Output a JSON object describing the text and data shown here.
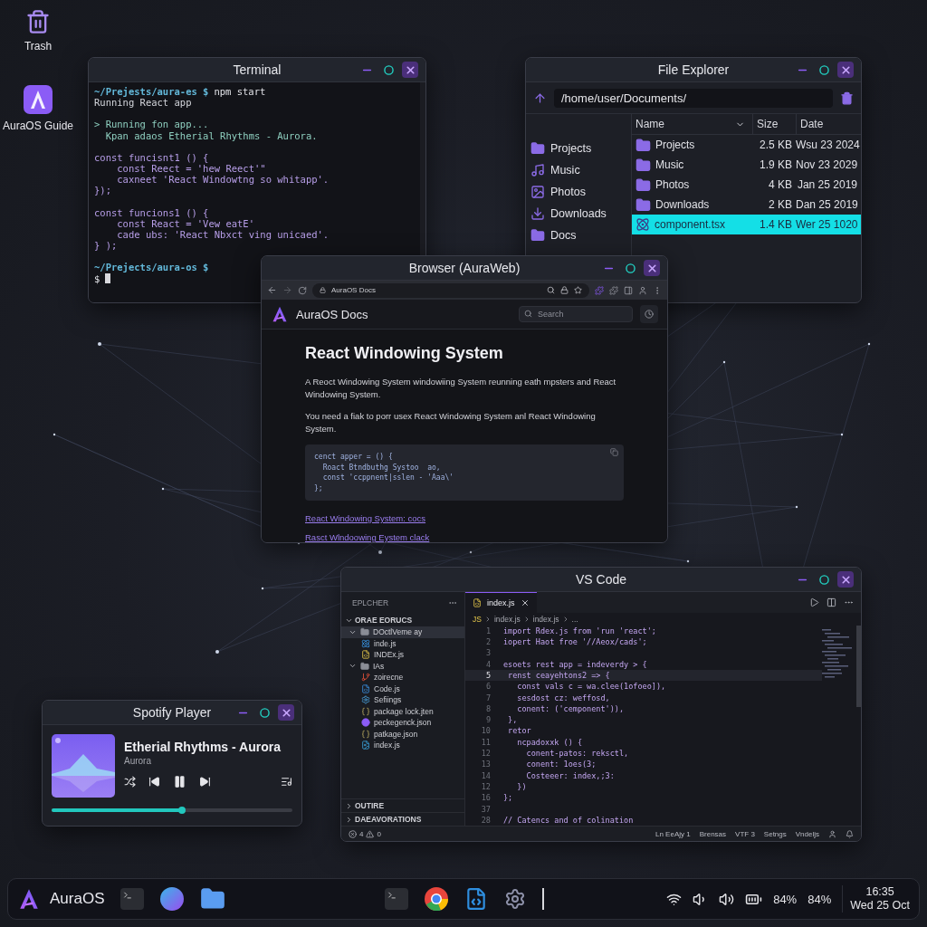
{
  "desktop_icons": [
    {
      "label": "Trash",
      "kind": "trash"
    },
    {
      "label": "AuraOS Guide",
      "kind": "guide"
    }
  ],
  "terminal": {
    "title": "Terminal",
    "blocks": [
      [
        {
          "kind": "prompt",
          "path": "~/Prejests/aura-es $",
          "command": "npm start"
        },
        {
          "kind": "output",
          "text": "Running React app"
        }
      ],
      [
        {
          "kind": "info",
          "text": "> Running fon app..."
        },
        {
          "kind": "info",
          "text": "  Kpan adaos Etherial Rhythms - Aurora."
        }
      ],
      [
        {
          "kind": "code",
          "text": "const funcisnt1 () {"
        },
        {
          "kind": "code",
          "text": "    const Reect = 'hew Reect'\""
        },
        {
          "kind": "code",
          "text": "    caxneet 'React Windowtng so whitapp'."
        },
        {
          "kind": "code",
          "text": "});"
        }
      ],
      [
        {
          "kind": "code",
          "text": "const funcions1 () {"
        },
        {
          "kind": "code",
          "text": "    const React = 'Vew eatE'"
        },
        {
          "kind": "code",
          "text": "    cade ubs: 'React Nbxct ving unicaed'."
        },
        {
          "kind": "code",
          "text": "} );"
        }
      ],
      [
        {
          "kind": "prompt",
          "path": "~/Prejects/aura-os $"
        },
        {
          "kind": "cursor",
          "text": "$"
        }
      ]
    ]
  },
  "file_explorer": {
    "title": "File Explorer",
    "path": "/home/user/Documents/",
    "sidebar": [
      {
        "label": "Projects",
        "kind": "folder"
      },
      {
        "label": "Music",
        "kind": "music"
      },
      {
        "label": "Photos",
        "kind": "photo"
      },
      {
        "label": "Downloads",
        "kind": "download"
      },
      {
        "label": "Docs",
        "kind": "folder"
      }
    ],
    "columns": [
      "Name",
      "Size",
      "Date"
    ],
    "rows": [
      {
        "name": "Projects",
        "size": "2.5 KB",
        "date": "Wsu 23 2024",
        "kind": "folder",
        "selected": false
      },
      {
        "name": "Music",
        "size": "1.9 KB",
        "date": "Nov 23 2029",
        "kind": "folder",
        "selected": false
      },
      {
        "name": "Photos",
        "size": "4 KB",
        "date": "Jan 25 2019",
        "kind": "folder",
        "selected": false
      },
      {
        "name": "Downloads",
        "size": "2 KB",
        "date": "Dan 25 2019",
        "kind": "folder",
        "selected": false
      },
      {
        "name": "component.tsx",
        "size": "1.4 KB",
        "date": "Wer 25 1020",
        "kind": "react",
        "selected": true
      }
    ]
  },
  "browser": {
    "title": "Browser (AuraWeb)",
    "address": "AuraOS Docs",
    "site_title": "AuraOS Docs",
    "search": {
      "placeholder": "Search"
    },
    "heading": "React Windowing System",
    "paragraphs": [
      "A Reoct Windowing System windowiing System reunning eath mpsters and React Windowing System.",
      "You need a fiak to porr usex React Windowing System anl React Windowing System."
    ],
    "code_lines": [
      "cenct apper = () {",
      "  Roact Btndbuthg Systoo  ao,",
      "  const 'ccppnent|sslen - 'Aaa\\'",
      "};"
    ],
    "links": [
      "React Windowing System: cocs",
      "Rasct Wlndoowing Eystem clack"
    ]
  },
  "vscode": {
    "title": "VS Code",
    "explorer_title": "EPLCHER",
    "section": "ORAE EORUCS",
    "tree": [
      {
        "label": "DOctlVeme ay",
        "kind": "folder",
        "expanded": true,
        "selected": true,
        "children": [
          {
            "label": "inde.js",
            "kind": "react",
            "selected": false
          },
          {
            "label": "INDEx.js",
            "kind": "js",
            "selected": false
          }
        ]
      },
      {
        "label": "IAs",
        "kind": "folder",
        "expanded": true,
        "selected": false,
        "children": [
          {
            "label": "zoirecne",
            "kind": "git",
            "selected": false
          },
          {
            "label": "Code.js",
            "kind": "vscode",
            "selected": false
          },
          {
            "label": "Sefiings",
            "kind": "settings",
            "selected": false
          },
          {
            "label": "package lock.jten",
            "kind": "json",
            "selected": false
          },
          {
            "label": "peckegenck.json",
            "kind": "purple",
            "selected": false
          },
          {
            "label": "patkage.json",
            "kind": "json",
            "selected": false
          },
          {
            "label": "index.js",
            "kind": "image",
            "selected": false
          }
        ]
      }
    ],
    "panels": [
      {
        "label": "OUTIRE",
        "expanded": false
      },
      {
        "label": "DAEAVORATIONS",
        "expanded": false
      }
    ],
    "tabs": [
      {
        "label": "index.js",
        "selected": true
      }
    ],
    "breadcrumb": [
      "JS",
      "index.js",
      "index.js",
      "..."
    ],
    "code_lines": [
      {
        "num": "1",
        "text": "import Rdex.js from 'run 'react';",
        "current": false
      },
      {
        "num": "2",
        "text": "iopert Haot froe '//Aeox/cads';",
        "current": false
      },
      {
        "num": "3",
        "current": false
      },
      {
        "num": "4",
        "text": "esoets rest app = indeverdy > {",
        "current": false
      },
      {
        "num": "5",
        "text": " renst ceayehtons2 => {",
        "current": true
      },
      {
        "num": "6",
        "text": "   const vals c = wa.clee(1ofoeo]),",
        "current": false
      },
      {
        "num": "7",
        "text": "   sesdost cz: weffosd,",
        "current": false
      },
      {
        "num": "8",
        "text": "   conent: ('cemponent')),",
        "current": false
      },
      {
        "num": "9",
        "text": " },",
        "current": false
      },
      {
        "num": "10",
        "text": " retor",
        "current": false
      },
      {
        "num": "11",
        "text": "   ncpadoxxk () {",
        "current": false
      },
      {
        "num": "12",
        "text": "     conent-patos: reksctl,",
        "current": false
      },
      {
        "num": "13",
        "text": "     conent: 1oes(3;",
        "current": false
      },
      {
        "num": "14",
        "text": "     Costeeer: index,;3:",
        "current": false
      },
      {
        "num": "12",
        "text": "   })",
        "current": false
      },
      {
        "num": "16",
        "text": "};",
        "current": false
      },
      {
        "num": "37",
        "current": false
      },
      {
        "num": "28",
        "text": "// Catencs and of colination",
        "current": false
      }
    ],
    "status": {
      "errors": "4",
      "warnings": "0",
      "items": [
        "Ln EeAjy 1",
        "Brensas",
        "VTF 3",
        "Setngs",
        "Vndeljs"
      ]
    }
  },
  "player": {
    "title": "Spotify Player",
    "track": "Etherial Rhythms - Aurora",
    "artist": "Aurora",
    "playing": true,
    "level": 0.54
  },
  "taskbar": {
    "brand": "AuraOS",
    "battery": "84%",
    "volume": "84%",
    "time": "16:35",
    "date": "Wed 25 Oct"
  }
}
